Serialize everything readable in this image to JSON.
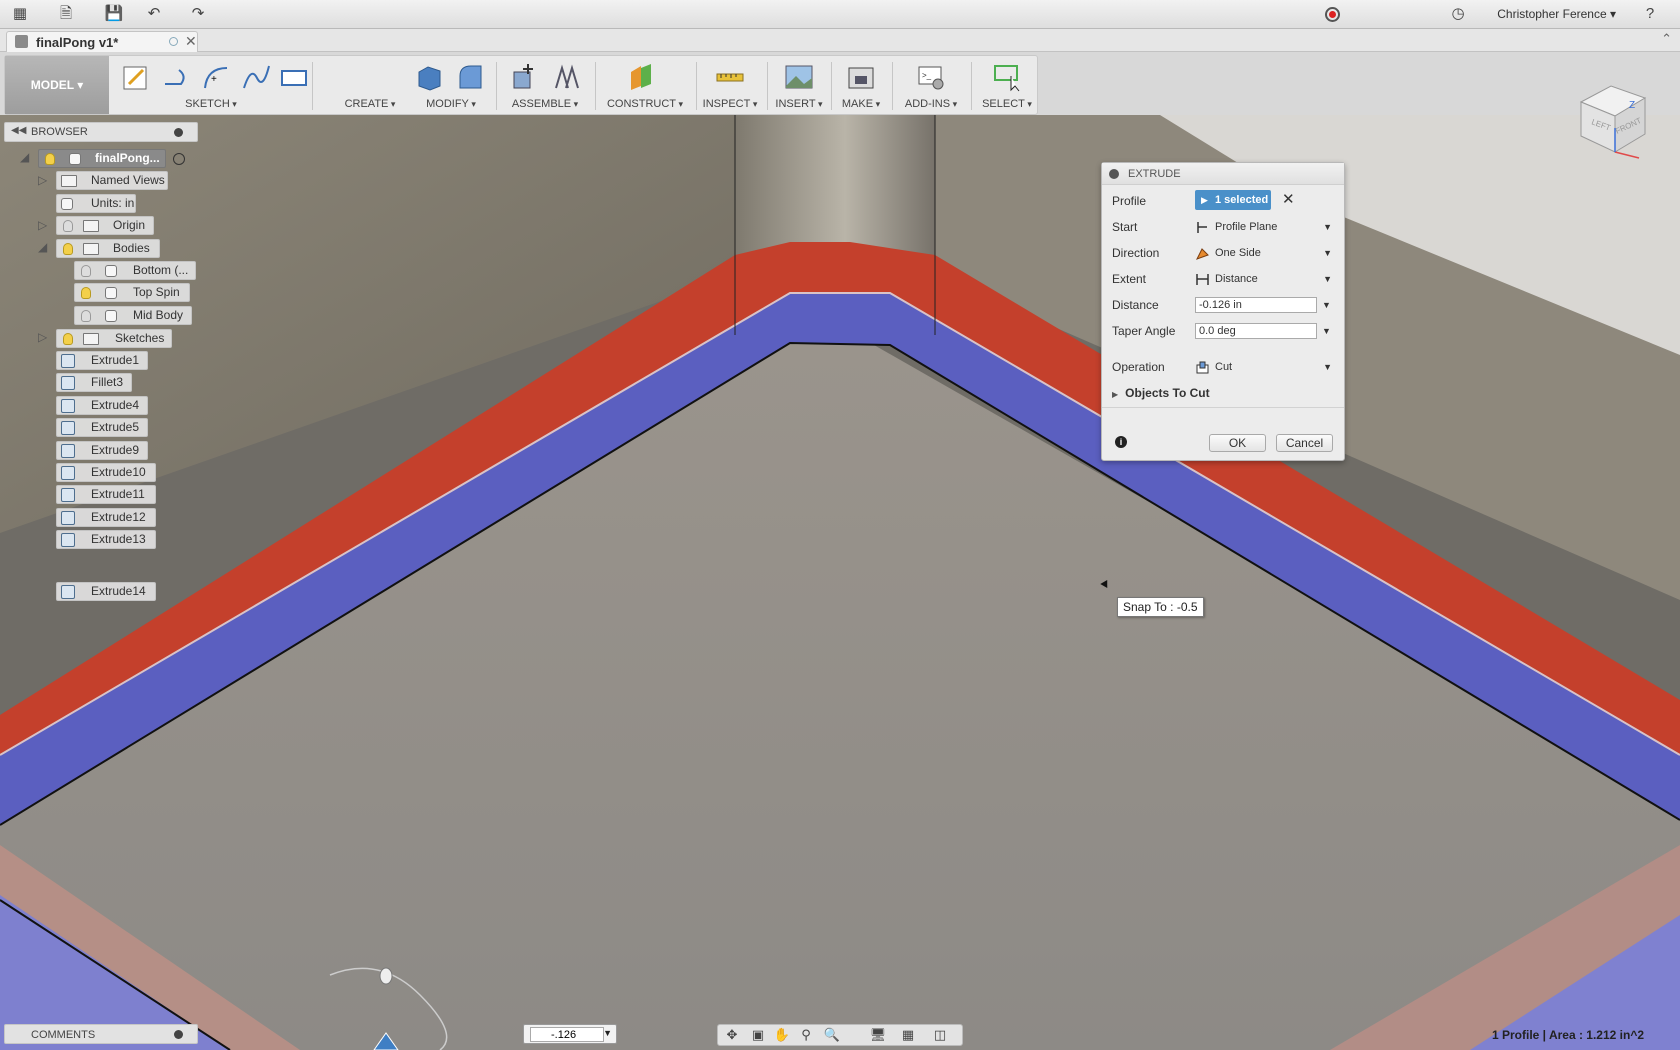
{
  "topbar": {
    "user_name": "Christopher Ference ▾",
    "help_label": "?"
  },
  "document": {
    "tab_name": "finalPong v1*"
  },
  "ribbon": {
    "workspace": "MODEL ▾",
    "groups": [
      "SKETCH",
      "CREATE",
      "MODIFY",
      "ASSEMBLE",
      "CONSTRUCT",
      "INSPECT",
      "INSERT",
      "MAKE",
      "ADD-INS",
      "SELECT"
    ]
  },
  "browser": {
    "title": "BROWSER",
    "root": "finalPong...",
    "items": {
      "named_views": "Named Views",
      "units": "Units: in",
      "origin": "Origin",
      "bodies": "Bodies",
      "body1": "Bottom (...",
      "body2": "Top Spin",
      "body3": "Mid Body",
      "sketches": "Sketches"
    },
    "features": [
      "Extrude1",
      "Fillet3",
      "Extrude4",
      "Extrude5",
      "Extrude9",
      "Extrude10",
      "Extrude11",
      "Extrude12",
      "Extrude13",
      "Extrude14"
    ]
  },
  "dialog": {
    "title": "EXTRUDE",
    "profile_label": "Profile",
    "profile_value": "1 selected",
    "start_label": "Start",
    "start_value": "Profile Plane",
    "direction_label": "Direction",
    "direction_value": "One Side",
    "extent_label": "Extent",
    "extent_value": "Distance",
    "distance_label": "Distance",
    "distance_value": "-0.126 in",
    "taper_label": "Taper Angle",
    "taper_value": "0.0 deg",
    "operation_label": "Operation",
    "operation_value": "Cut",
    "objects_to_cut": "Objects To Cut",
    "ok": "OK",
    "cancel": "Cancel"
  },
  "viewport": {
    "snap_tooltip": "Snap To : -0.5",
    "viewcube_faces": [
      "LEFT",
      "FRONT",
      "Z"
    ]
  },
  "bottom": {
    "comments": "COMMENTS",
    "value_input": "-.126",
    "status_profile": "1 Profile",
    "status_sep": " | ",
    "status_area": "Area : 1.212 in^2"
  },
  "colors": {
    "cut_red": "#c4402c",
    "cut_blue": "#5b5fc0",
    "selection_blue": "#4a90c9"
  }
}
